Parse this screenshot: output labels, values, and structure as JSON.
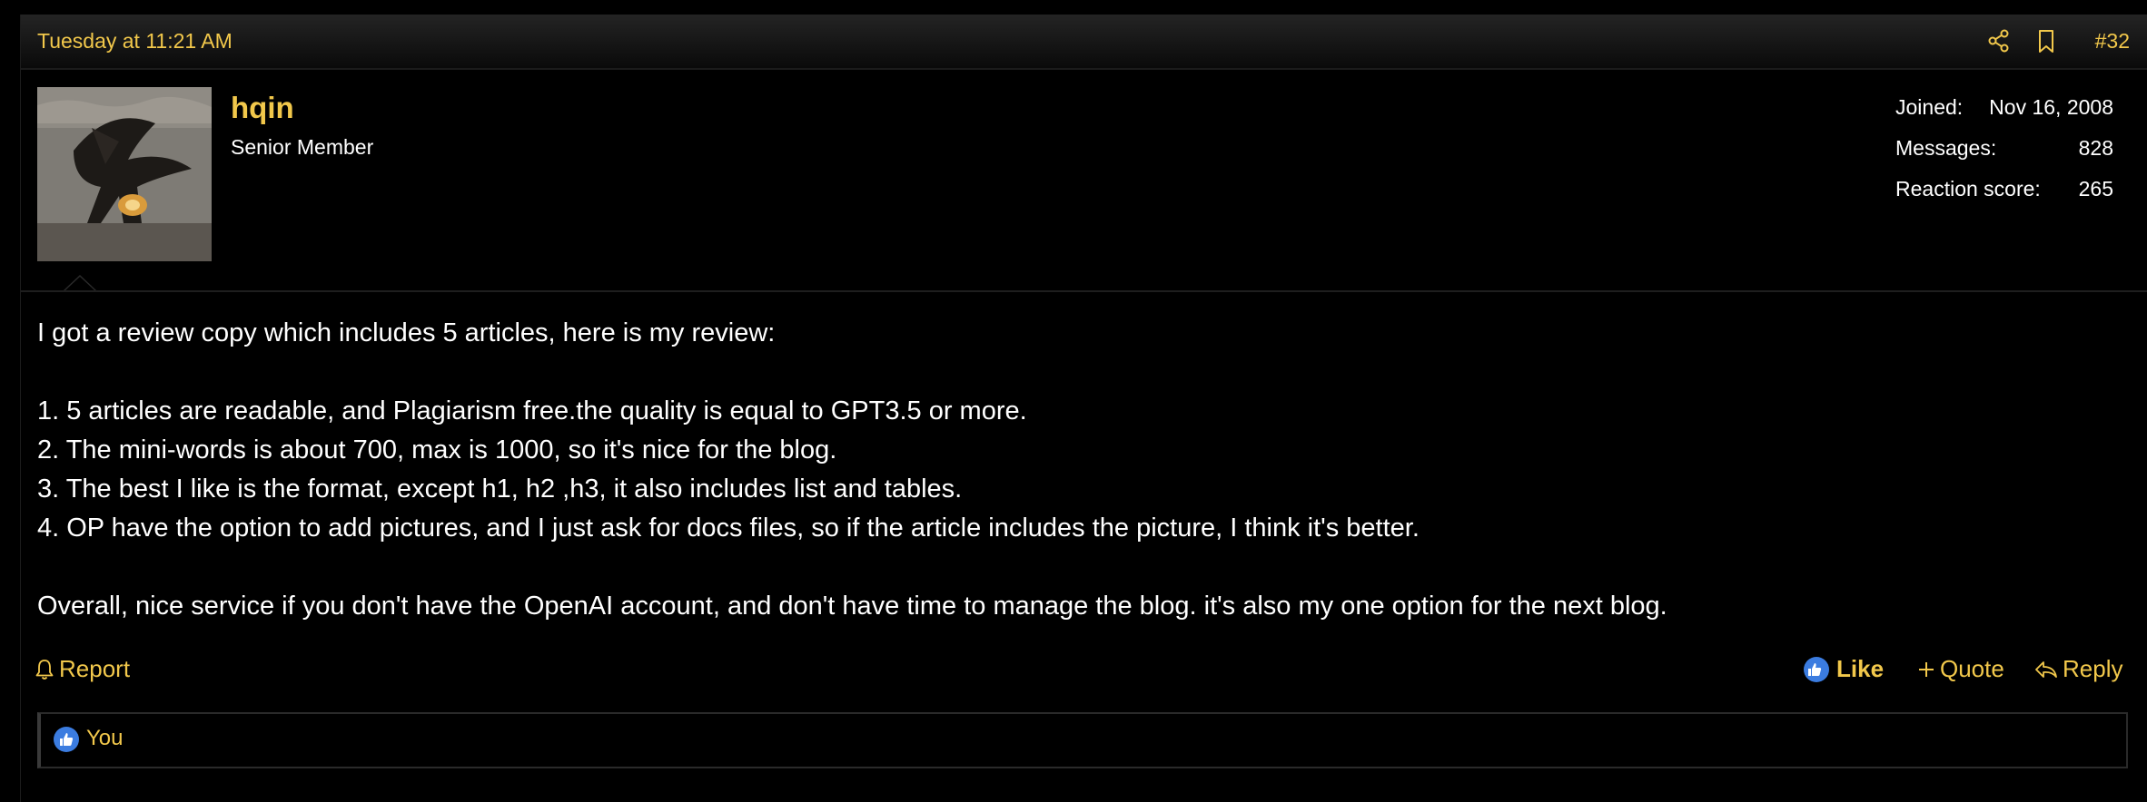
{
  "header": {
    "date": "Tuesday at 11:21 AM",
    "post_number": "#32",
    "share_icon": "share-icon",
    "bookmark_icon": "bookmark-icon"
  },
  "user": {
    "name": "hqin",
    "title": "Senior Member",
    "avatar": "dragon-avatar",
    "stats": [
      {
        "label": "Joined:",
        "value": "Nov 16, 2008"
      },
      {
        "label": "Messages:",
        "value": "828"
      },
      {
        "label": "Reaction score:",
        "value": "265"
      }
    ]
  },
  "body": {
    "intro": "I got a review copy which includes 5 articles, here is my review:",
    "points": [
      "1. 5 articles are readable, and Plagiarism free.the quality is equal to GPT3.5 or more.",
      "2. The mini-words is about 700, max is 1000, so it's nice for the blog.",
      "3. The best I like is the format, except h1, h2 ,h3, it also includes list and tables.",
      "4. OP have the option to add pictures, and I just ask for docs files, so if the article includes the picture, I think it's better."
    ],
    "closing": "Overall, nice service if you don't have the OpenAI account, and don't have time to manage the blog. it's also my one option for the next blog."
  },
  "actions": {
    "report": "Report",
    "like": "Like",
    "quote": "Quote",
    "reply": "Reply"
  },
  "reactions": {
    "users": "You"
  },
  "colors": {
    "accent": "#f2c84b",
    "like_blue": "#3b7ce0",
    "background": "#000000"
  }
}
